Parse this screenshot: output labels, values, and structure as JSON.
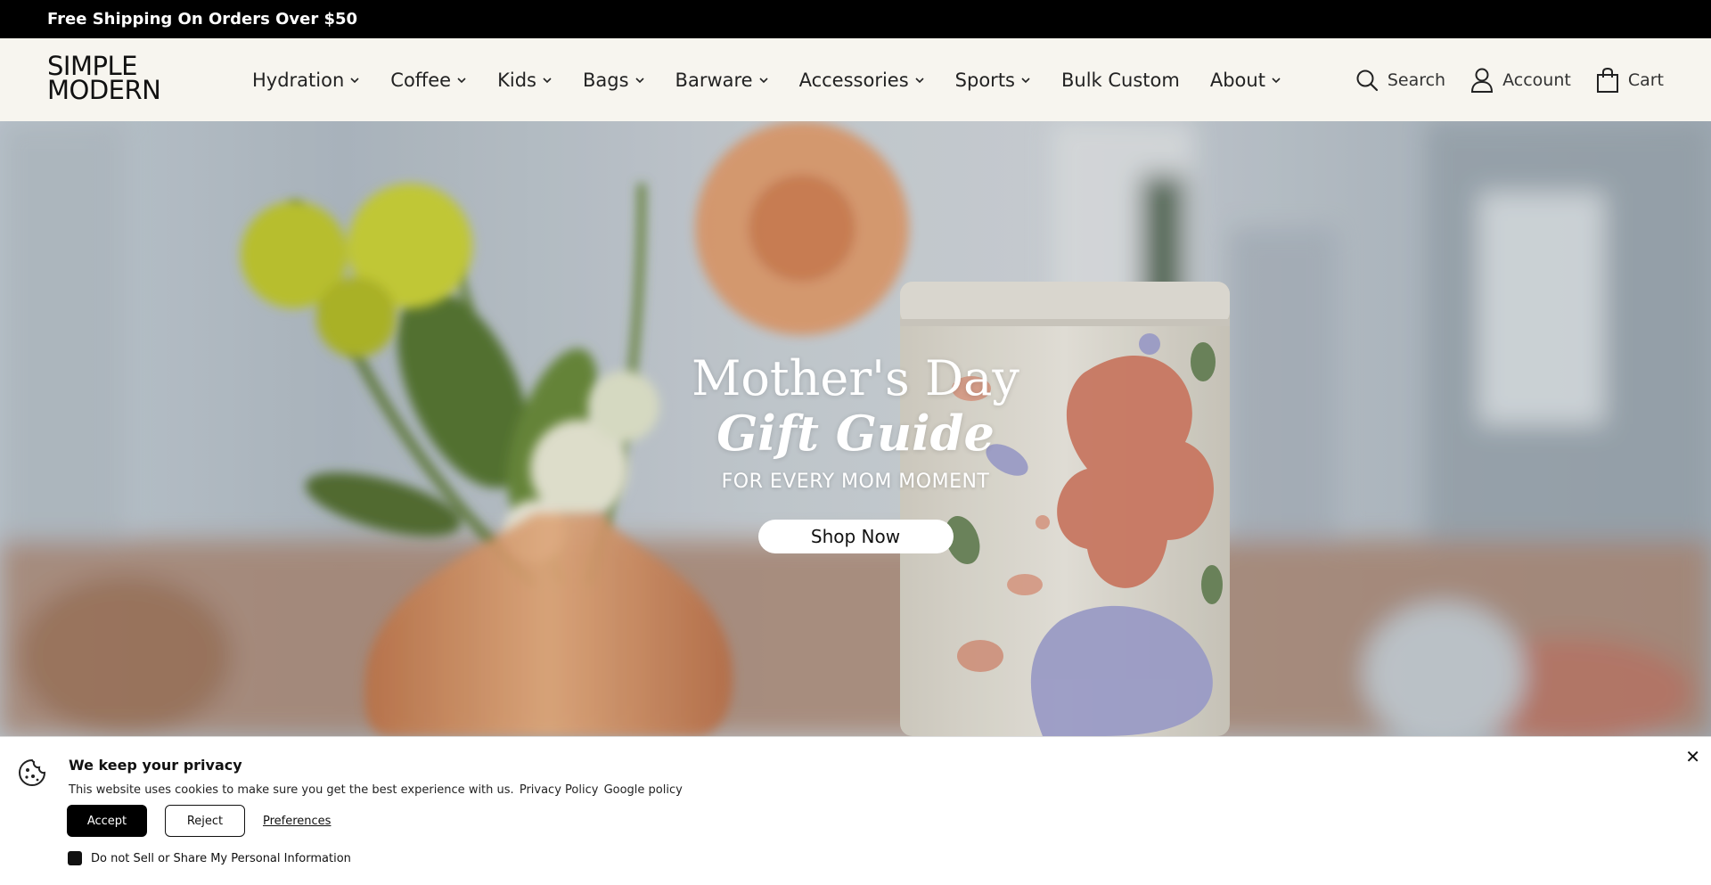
{
  "announcement": {
    "text": "Free Shipping On Orders Over $50"
  },
  "header": {
    "logo_line1": "SIMPLE",
    "logo_line2": "MODERN",
    "nav": [
      {
        "label": "Hydration",
        "has_dropdown": true
      },
      {
        "label": "Coffee",
        "has_dropdown": true
      },
      {
        "label": "Kids",
        "has_dropdown": true
      },
      {
        "label": "Bags",
        "has_dropdown": true
      },
      {
        "label": "Barware",
        "has_dropdown": true
      },
      {
        "label": "Accessories",
        "has_dropdown": true
      },
      {
        "label": "Sports",
        "has_dropdown": true
      },
      {
        "label": "Bulk Custom",
        "has_dropdown": false
      },
      {
        "label": "About",
        "has_dropdown": true
      }
    ],
    "utils": {
      "search": "Search",
      "account": "Account",
      "cart": "Cart"
    }
  },
  "hero": {
    "title": "Mother's Day",
    "title_italic": "Gift Guide",
    "subtitle": "FOR EVERY MOM MOMENT",
    "cta": "Shop Now"
  },
  "cookie_banner": {
    "title": "We keep your privacy",
    "text": "This website uses cookies to make sure you get the best experience with us.",
    "privacy_link": "Privacy Policy",
    "google_link": "Google policy",
    "accept": "Accept",
    "reject": "Reject",
    "preferences": "Preferences",
    "do_not_sell": "Do not Sell or Share My Personal Information",
    "close": "✕"
  },
  "colors": {
    "announcement_bg": "#000000",
    "header_bg": "#f7f5ef",
    "accent_dark": "#111111"
  }
}
